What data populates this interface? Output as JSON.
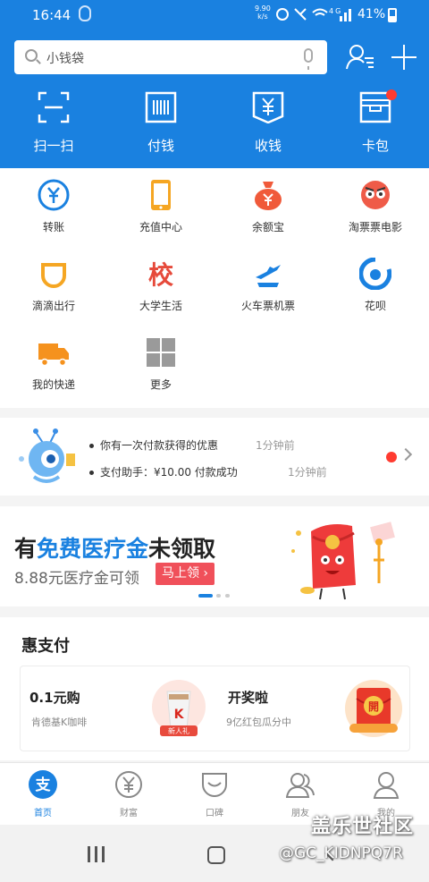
{
  "status_bar": {
    "time": "16:44",
    "speed_value": "9.90",
    "speed_unit": "k/s",
    "network": "4G",
    "battery": "41%"
  },
  "search": {
    "placeholder": "小钱袋"
  },
  "top_actions": [
    {
      "label": "扫一扫",
      "icon": "scan-icon"
    },
    {
      "label": "付钱",
      "icon": "pay-barcode-icon"
    },
    {
      "label": "收钱",
      "icon": "receive-money-icon"
    },
    {
      "label": "卡包",
      "icon": "card-wallet-icon"
    }
  ],
  "grid": [
    {
      "label": "转账",
      "icon": "transfer-icon"
    },
    {
      "label": "充值中心",
      "icon": "phone-topup-icon"
    },
    {
      "label": "余额宝",
      "icon": "money-bag-icon"
    },
    {
      "label": "淘票票电影",
      "icon": "movie-ticket-icon"
    },
    {
      "label": "滴滴出行",
      "icon": "didi-icon"
    },
    {
      "label": "大学生活",
      "icon": "campus-icon"
    },
    {
      "label": "火车票机票",
      "icon": "train-plane-icon"
    },
    {
      "label": "花呗",
      "icon": "huabei-icon"
    },
    {
      "label": "我的快递",
      "icon": "delivery-truck-icon"
    },
    {
      "label": "更多",
      "icon": "more-grid-icon"
    }
  ],
  "notifications": [
    {
      "text": "你有一次付款获得的优惠",
      "time": "1分钟前"
    },
    {
      "text": "支付助手：¥10.00 付款成功",
      "time": "1分钟前"
    }
  ],
  "banner": {
    "title_a": "有",
    "title_highlight": "免费医疗金",
    "title_b": "未领取",
    "subtitle": "8.88元医疗金可领",
    "button": "马上领 ›"
  },
  "hui": {
    "title": "惠支付",
    "offers": [
      {
        "name": "0.1元购",
        "desc": "肯德基K咖啡",
        "badge": "新人礼"
      },
      {
        "name": "开奖啦",
        "desc": "9亿红包瓜分中",
        "badge": "開"
      }
    ]
  },
  "tabs": [
    {
      "label": "首页",
      "icon": "home-you-icon",
      "active": true
    },
    {
      "label": "财富",
      "icon": "wealth-yen-icon"
    },
    {
      "label": "口碑",
      "icon": "koubei-smile-icon"
    },
    {
      "label": "朋友",
      "icon": "friends-icon"
    },
    {
      "label": "我的",
      "icon": "profile-icon"
    }
  ],
  "watermark": {
    "line1": "盖乐世社区",
    "line2": "@GC_KIDNPQ7R"
  },
  "colors": {
    "brand_blue": "#1a81e0",
    "alert_red": "#ff3b30",
    "banner_button": "#f0505a"
  }
}
